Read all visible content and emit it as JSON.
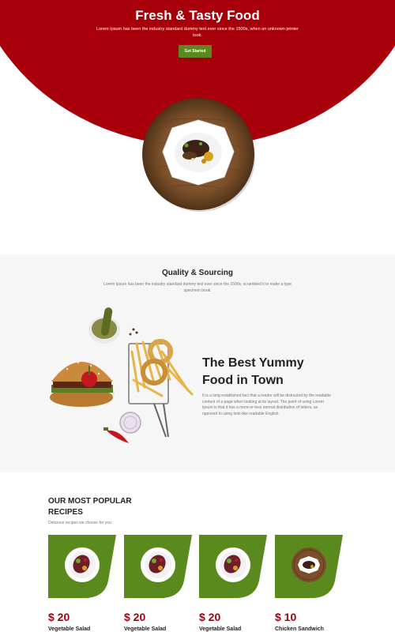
{
  "hero": {
    "title": "Fresh & Tasty Food",
    "subtitle": "Lorem Ipsum has been the industry standard dummy text ever since the 1500s, when an unknown printer took.",
    "button_label": "Get Started"
  },
  "quality": {
    "title": "Quality & Sourcing",
    "subtitle": "Lorem Ipsum has been the industry standard dummy text ever since the 1500s, scrambled it to make a type specimen book."
  },
  "feature": {
    "title_line1": "The Best Yummy",
    "title_line2": "Food in Town",
    "body": "It is a long established fact that a reader will be distracted by the readable content of a page when looking at its layout. The point of using Lorem Ipsum is that it has a more-or-less normal distribution of letters, as opposed to using look-like readable English."
  },
  "popular": {
    "title_line1": "OUR MOST POPULAR",
    "title_line2": "RECIPES",
    "subtitle": "Delicious recipes we choose for you",
    "cards": [
      {
        "price": "$ 20",
        "name": "Vegetable Salad"
      },
      {
        "price": "$ 20",
        "name": "Vegetable Salad"
      },
      {
        "price": "$ 20",
        "name": "Vegetable Salad"
      },
      {
        "price": "$ 10",
        "name": "Chicken Sandwich"
      }
    ]
  },
  "colors": {
    "primary_red": "#a8000a",
    "accent_green": "#5a8a1e"
  }
}
